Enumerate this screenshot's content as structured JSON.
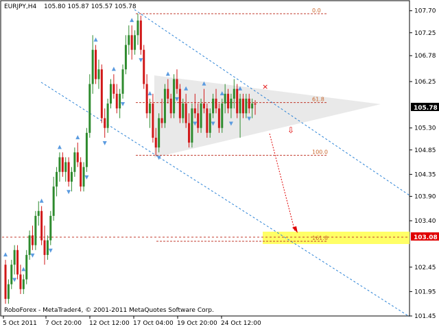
{
  "header": {
    "symbol": "EURJPY,H4",
    "ohlc": "105.80 105.87 105.57 105.78"
  },
  "footer": {
    "copyright": "RoboForex - MetaTrader4, © 2001-2011 MetaQuotes Software Corp."
  },
  "colors": {
    "bull": "#2e8b2e",
    "bear": "#d01818",
    "channel": "#2a82d6",
    "fib": "#c0392b",
    "triangle": "#e9e9e9",
    "target_zone": "#ffff66",
    "price_tag_current": "#000000",
    "price_tag_target": "#e00000"
  },
  "chart_data": {
    "type": "candlestick",
    "ylim": [
      101.45,
      107.85
    ],
    "y_ticks": [
      "107.70",
      "107.25",
      "106.78",
      "106.25",
      "105.78",
      "105.30",
      "104.85",
      "104.35",
      "103.90",
      "103.40",
      "103.08",
      "102.45",
      "101.95",
      "101.45"
    ],
    "x_ticks": [
      "5 Oct 2011",
      "7 Oct 20:00",
      "12 Oct 12:00",
      "17 Oct 04:00",
      "19 Oct 20:00",
      "24 Oct 12:00"
    ],
    "current_price": "105.78",
    "target_price": "103.08",
    "fib_levels": [
      {
        "label": "0.0",
        "price": 107.64
      },
      {
        "label": "61.8",
        "price": 105.82
      },
      {
        "label": "100.0",
        "price": 104.74
      },
      {
        "label": "161.8",
        "price": 102.98
      }
    ],
    "target_line": 103.08,
    "candles": [
      [
        102.5,
        102.6,
        101.7,
        101.8
      ],
      [
        101.8,
        102.2,
        101.7,
        102.1
      ],
      [
        102.1,
        102.6,
        102.0,
        102.5
      ],
      [
        102.5,
        102.9,
        102.3,
        102.8
      ],
      [
        102.8,
        102.9,
        102.2,
        102.3
      ],
      [
        102.3,
        102.5,
        101.9,
        102.0
      ],
      [
        102.0,
        102.3,
        101.9,
        102.2
      ],
      [
        102.2,
        102.8,
        102.1,
        102.7
      ],
      [
        102.7,
        103.2,
        102.6,
        103.1
      ],
      [
        103.1,
        103.3,
        102.8,
        102.9
      ],
      [
        102.9,
        103.6,
        102.8,
        103.5
      ],
      [
        103.5,
        103.8,
        103.3,
        103.6
      ],
      [
        103.6,
        103.7,
        102.9,
        103.0
      ],
      [
        103.0,
        103.3,
        102.5,
        102.7
      ],
      [
        102.7,
        103.1,
        102.6,
        103.0
      ],
      [
        103.0,
        103.6,
        102.9,
        103.5
      ],
      [
        103.5,
        104.3,
        103.4,
        104.1
      ],
      [
        104.1,
        104.5,
        103.9,
        104.4
      ],
      [
        104.4,
        104.8,
        104.2,
        104.7
      ],
      [
        104.7,
        104.8,
        104.3,
        104.4
      ],
      [
        104.4,
        104.7,
        104.2,
        104.6
      ],
      [
        104.6,
        104.7,
        104.1,
        104.2
      ],
      [
        104.2,
        104.5,
        104.0,
        104.4
      ],
      [
        104.4,
        104.9,
        104.3,
        104.8
      ],
      [
        104.8,
        105.0,
        104.5,
        104.6
      ],
      [
        104.6,
        104.7,
        104.0,
        104.1
      ],
      [
        104.1,
        104.6,
        104.0,
        104.5
      ],
      [
        104.5,
        105.3,
        104.4,
        105.2
      ],
      [
        105.2,
        106.4,
        105.1,
        106.2
      ],
      [
        106.2,
        107.2,
        106.0,
        106.9
      ],
      [
        106.9,
        107.0,
        106.2,
        106.3
      ],
      [
        106.3,
        106.7,
        106.1,
        106.5
      ],
      [
        106.5,
        106.6,
        105.4,
        105.5
      ],
      [
        105.5,
        105.7,
        105.1,
        105.3
      ],
      [
        105.3,
        105.9,
        105.2,
        105.8
      ],
      [
        105.8,
        106.3,
        105.7,
        106.2
      ],
      [
        106.2,
        106.4,
        105.9,
        106.0
      ],
      [
        106.0,
        106.2,
        105.6,
        105.7
      ],
      [
        105.7,
        106.1,
        105.5,
        106.0
      ],
      [
        106.0,
        106.6,
        105.9,
        106.5
      ],
      [
        106.5,
        107.2,
        106.4,
        107.0
      ],
      [
        107.0,
        107.4,
        106.8,
        107.2
      ],
      [
        107.2,
        107.4,
        106.7,
        106.9
      ],
      [
        106.9,
        107.3,
        106.8,
        107.2
      ],
      [
        107.2,
        107.64,
        107.0,
        107.5
      ],
      [
        107.5,
        107.6,
        106.8,
        106.9
      ],
      [
        106.9,
        107.0,
        106.1,
        106.2
      ],
      [
        106.2,
        106.4,
        105.5,
        105.6
      ],
      [
        105.6,
        105.9,
        105.3,
        105.8
      ],
      [
        105.8,
        106.0,
        105.0,
        105.1
      ],
      [
        105.1,
        105.3,
        104.74,
        104.9
      ],
      [
        104.9,
        105.6,
        104.8,
        105.5
      ],
      [
        105.5,
        105.9,
        105.3,
        105.4
      ],
      [
        105.4,
        106.2,
        105.3,
        106.1
      ],
      [
        106.1,
        106.3,
        105.8,
        105.9
      ],
      [
        105.9,
        106.0,
        105.5,
        105.6
      ],
      [
        105.6,
        106.4,
        105.5,
        106.3
      ],
      [
        106.3,
        106.5,
        106.0,
        106.1
      ],
      [
        106.1,
        106.2,
        105.4,
        105.5
      ],
      [
        105.5,
        105.9,
        105.4,
        105.8
      ],
      [
        105.8,
        106.0,
        105.3,
        105.4
      ],
      [
        105.4,
        105.6,
        104.9,
        105.0
      ],
      [
        105.0,
        105.8,
        104.9,
        105.7
      ],
      [
        105.7,
        106.0,
        105.5,
        105.6
      ],
      [
        105.6,
        105.8,
        105.2,
        105.3
      ],
      [
        105.3,
        105.9,
        105.2,
        105.8
      ],
      [
        105.8,
        106.1,
        105.6,
        105.7
      ],
      [
        105.7,
        105.8,
        105.1,
        105.2
      ],
      [
        105.2,
        105.7,
        105.1,
        105.6
      ],
      [
        105.6,
        106.0,
        105.5,
        105.9
      ],
      [
        105.9,
        106.1,
        105.6,
        105.7
      ],
      [
        105.7,
        105.8,
        105.2,
        105.3
      ],
      [
        105.3,
        105.9,
        105.2,
        105.8
      ],
      [
        105.8,
        106.2,
        105.6,
        106.0
      ],
      [
        106.0,
        106.1,
        105.6,
        105.7
      ],
      [
        105.7,
        106.0,
        105.5,
        105.9
      ],
      [
        105.9,
        106.3,
        105.7,
        106.1
      ],
      [
        106.1,
        106.2,
        105.5,
        105.6
      ],
      [
        105.6,
        106.0,
        105.1,
        105.9
      ],
      [
        105.9,
        106.0,
        105.5,
        105.6
      ],
      [
        105.6,
        106.0,
        105.5,
        105.9
      ],
      [
        105.9,
        106.0,
        105.6,
        105.7
      ],
      [
        105.7,
        105.9,
        105.5,
        105.8
      ],
      [
        105.8,
        105.87,
        105.57,
        105.78
      ]
    ]
  }
}
